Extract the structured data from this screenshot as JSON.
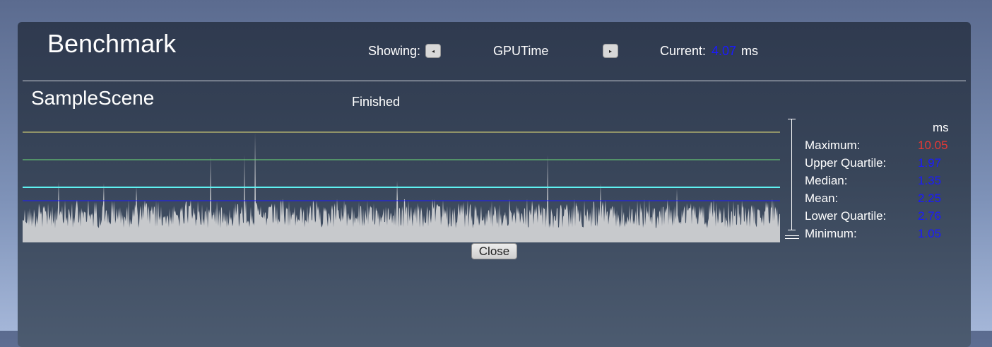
{
  "header": {
    "title": "Benchmark",
    "showing_label": "Showing:",
    "prev_glyph": "◂",
    "metric_name": "GPUTime",
    "next_glyph": "▸",
    "current_label": "Current:",
    "current_value": "4.07",
    "current_unit": "ms"
  },
  "scene": {
    "name": "SampleScene",
    "status": "Finished"
  },
  "stats": {
    "unit": "ms",
    "items": [
      {
        "label": "Maximum:",
        "value": "10.05"
      },
      {
        "label": "Upper Quartile:",
        "value": "1.97"
      },
      {
        "label": "Median:",
        "value": "1.35"
      },
      {
        "label": "Mean:",
        "value": "2.25"
      },
      {
        "label": "Lower Quartile:",
        "value": "2.76"
      },
      {
        "label": "Minimum:",
        "value": "1.05"
      }
    ]
  },
  "colors": {
    "max_line": "#e8e27a",
    "upper_quartile_line": "#6fe07a",
    "median_line": "#5ff2f2",
    "mean_line": "#1a1aff",
    "samples_fill": "#c7c9cc",
    "value_blue": "#1a1aff",
    "value_red": "#e53935"
  },
  "close_button": {
    "label": "Close"
  }
}
